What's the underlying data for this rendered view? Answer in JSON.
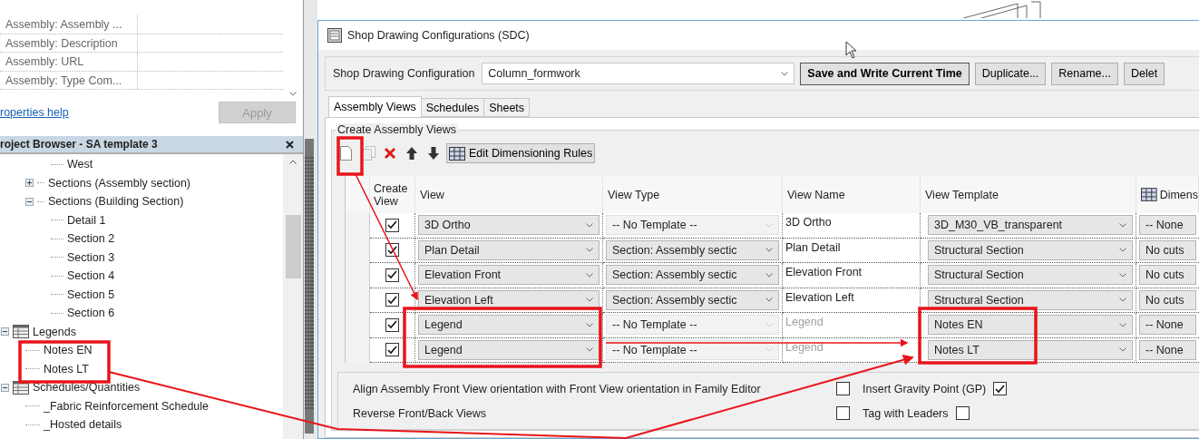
{
  "properties": {
    "rows": [
      {
        "name": "Assembly: Assembly ..."
      },
      {
        "name": "Assembly: Description"
      },
      {
        "name": "Assembly: URL"
      },
      {
        "name": "Assembly: Type Com..."
      }
    ],
    "help_link": "roperties help",
    "apply_button": {
      "label": "Apply",
      "disabled": true
    }
  },
  "project_browser": {
    "title": "roject Browser - SA template 3",
    "tree": {
      "continued": [
        {
          "label": "West"
        }
      ],
      "section_groups": [
        {
          "label": "Sections (Assembly section)",
          "expanded": false
        },
        {
          "label": "Sections (Building Section)",
          "expanded": true,
          "children": [
            {
              "label": "Detail 1"
            },
            {
              "label": "Section 2"
            },
            {
              "label": "Section 3"
            },
            {
              "label": "Section 4"
            },
            {
              "label": "Section 5"
            },
            {
              "label": "Section 6"
            }
          ]
        }
      ],
      "categories": [
        {
          "label": "Legends",
          "expanded": true,
          "children": [
            {
              "label": "Notes EN"
            },
            {
              "label": "Notes LT"
            }
          ]
        },
        {
          "label": "Schedules/Quantities",
          "expanded": true,
          "children": [
            {
              "label": "_Fabric Reinforcement Schedule"
            },
            {
              "label": "_Hosted details"
            }
          ]
        }
      ]
    }
  },
  "dialog": {
    "title": "Shop Drawing Configurations (SDC)",
    "config": {
      "label": "Shop Drawing Configuration",
      "value": "Column_formwork",
      "buttons": [
        {
          "label": "Save and Write Current Time",
          "primary": true
        },
        {
          "label": "Duplicate...",
          "primary": false
        },
        {
          "label": "Rename...",
          "primary": false
        },
        {
          "label": "Delet",
          "primary": false
        }
      ]
    },
    "tabs": [
      {
        "label": "Assembly Views",
        "selected": true
      },
      {
        "label": "Schedules",
        "selected": false
      },
      {
        "label": "Sheets",
        "selected": false
      }
    ],
    "group_title": "Create Assembly Views",
    "toolbar": [
      {
        "kind": "new",
        "disabled": false
      },
      {
        "kind": "copy",
        "disabled": true
      },
      {
        "kind": "delete",
        "disabled": false
      },
      {
        "kind": "up",
        "disabled": false
      },
      {
        "kind": "down",
        "disabled": false
      },
      {
        "kind": "rules",
        "disabled": false,
        "label": "Edit Dimensioning Rules"
      }
    ],
    "grid": {
      "columns": [
        {
          "label": "Create View"
        },
        {
          "label": "View"
        },
        {
          "label": "View Type"
        },
        {
          "label": "View Name"
        },
        {
          "label": "View Template"
        },
        {
          "label": "Dimens"
        }
      ],
      "rows": [
        {
          "create": true,
          "view": "3D Ortho",
          "view_type": {
            "value": "-- No Template --",
            "disabled": true
          },
          "view_name": {
            "value": "3D Ortho",
            "disabled": false
          },
          "view_template": "3D_M30_VB_transparent",
          "dimension": "-- None"
        },
        {
          "create": true,
          "view": "Plan Detail",
          "view_type": {
            "value": "Section: Assembly sectic",
            "disabled": false
          },
          "view_name": {
            "value": "Plan Detail",
            "disabled": false
          },
          "view_template": "Structural Section",
          "dimension": "No cuts"
        },
        {
          "create": true,
          "view": "Elevation Front",
          "view_type": {
            "value": "Section: Assembly sectic",
            "disabled": false
          },
          "view_name": {
            "value": "Elevation Front",
            "disabled": false
          },
          "view_template": "Structural Section",
          "dimension": "No cuts"
        },
        {
          "create": true,
          "view": "Elevation Left",
          "view_type": {
            "value": "Section: Assembly sectic",
            "disabled": false
          },
          "view_name": {
            "value": "Elevation Left",
            "disabled": false
          },
          "view_template": "Structural Section",
          "dimension": "No cuts"
        },
        {
          "create": true,
          "view": "Legend",
          "view_type": {
            "value": "-- No Template --",
            "disabled": true
          },
          "view_name": {
            "value": "Legend",
            "disabled": true
          },
          "view_template": "Notes EN",
          "dimension": "-- None"
        },
        {
          "create": true,
          "view": "Legend",
          "view_type": {
            "value": "-- No Template --",
            "disabled": true
          },
          "view_name": {
            "value": "Legend",
            "disabled": true
          },
          "view_template": "Notes LT",
          "dimension": "-- None"
        }
      ]
    },
    "options": [
      {
        "label": "Align Assembly Front View orientation with Front View orientation in Family Editor",
        "checked": false
      },
      {
        "label": "Insert Gravity Point (GP)",
        "checked": true
      },
      {
        "label": "Reverse Front/Back Views",
        "checked": false
      },
      {
        "label": "Tag with Leaders",
        "checked": false
      }
    ]
  }
}
